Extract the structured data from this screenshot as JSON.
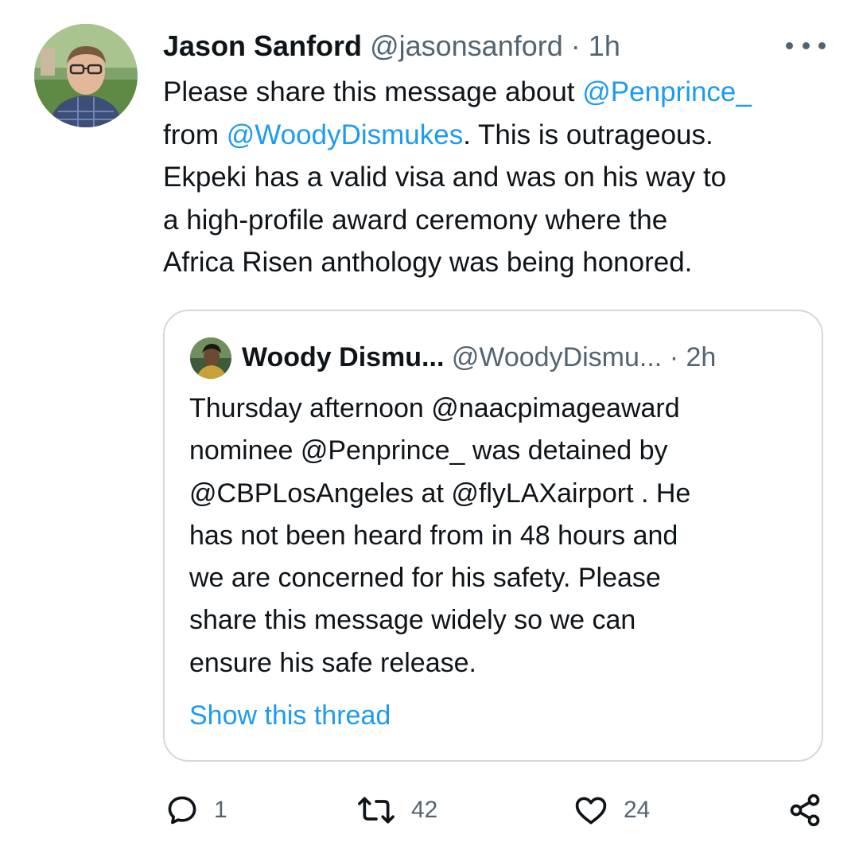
{
  "tweet": {
    "author_name": "Jason Sanford",
    "author_handle": "@jasonsanford",
    "separator": "·",
    "time": "1h",
    "text_lines": [
      [
        {
          "t": "Please share this message about ",
          "m": false
        },
        {
          "t": "@Penprince_",
          "m": true
        }
      ],
      [
        {
          "t": "from ",
          "m": false
        },
        {
          "t": "@WoodyDismukes",
          "m": true
        },
        {
          "t": ". This is outrageous.",
          "m": false
        }
      ],
      [
        {
          "t": "Ekpeki has a valid visa and was on his way to",
          "m": false
        }
      ],
      [
        {
          "t": "a high-profile award ceremony where the",
          "m": false
        }
      ],
      [
        {
          "t": "Africa Risen anthology was being honored.",
          "m": false
        }
      ]
    ],
    "more_icon": "more-horizontal-icon"
  },
  "quoted_tweet": {
    "author_name": "Woody Dismu...",
    "author_handle": "@WoodyDismu...",
    "separator": "·",
    "time": "2h",
    "text_lines": [
      "Thursday afternoon @naacpimageaward",
      "nominee @Penprince_ was detained by",
      "@CBPLosAngeles at @flyLAXairport . He",
      "has not been heard from in 48 hours and",
      "we are concerned for his safety. Please",
      "share this message widely so we can",
      "ensure his safe release."
    ],
    "show_thread_label": "Show this thread"
  },
  "actions": {
    "reply_count": "1",
    "retweet_count": "42",
    "like_count": "24",
    "icons": [
      "reply-icon",
      "retweet-icon",
      "like-icon",
      "share-icon"
    ]
  },
  "colors": {
    "link": "#1d9bf0",
    "secondary_text": "#536471",
    "primary_text": "#0f1419",
    "border": "#cfd9de"
  }
}
